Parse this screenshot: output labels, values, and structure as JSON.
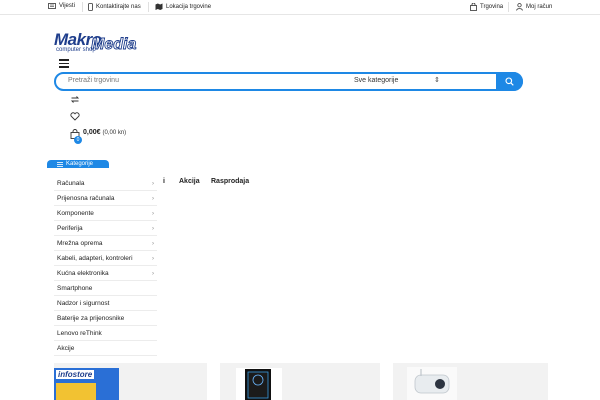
{
  "topbar": {
    "news": "Vijesti",
    "contact": "Kontaktirajte nas",
    "location": "Lokacija trgovine",
    "shop": "Trgovina",
    "account": "Moj račun"
  },
  "logo": {
    "brand": "Makro",
    "brand2": "Media",
    "tagline": "computer shop"
  },
  "search": {
    "placeholder": "Pretraži trgovinu",
    "category": "Sve kategorije"
  },
  "cart": {
    "count": "0",
    "price": "0,00€",
    "price_kn": "(0,00 kn)"
  },
  "categories": {
    "title": "Kategorije",
    "items": [
      {
        "label": "Računala",
        "arrow": true
      },
      {
        "label": "Prijenosna računala",
        "arrow": true
      },
      {
        "label": "Komponente",
        "arrow": true
      },
      {
        "label": "Periferija",
        "arrow": true
      },
      {
        "label": "Mrežna oprema",
        "arrow": true
      },
      {
        "label": "Kabeli, adapteri, kontroleri",
        "arrow": true
      },
      {
        "label": "Kućna elektronika",
        "arrow": true
      },
      {
        "label": "Smartphone",
        "arrow": false
      },
      {
        "label": "Nadzor i sigurnost",
        "arrow": false
      },
      {
        "label": "Baterije za prijenosnike",
        "arrow": false
      },
      {
        "label": "Lenovo reThink",
        "arrow": false
      },
      {
        "label": "Akcije",
        "arrow": false
      }
    ]
  },
  "nav": {
    "partial": "i",
    "deals": "Akcija",
    "sale": "Rasprodaja"
  },
  "promo": {
    "infostore": "infostore"
  },
  "colors": {
    "accent": "#1e88e5",
    "logo": "#1f3e8c"
  }
}
